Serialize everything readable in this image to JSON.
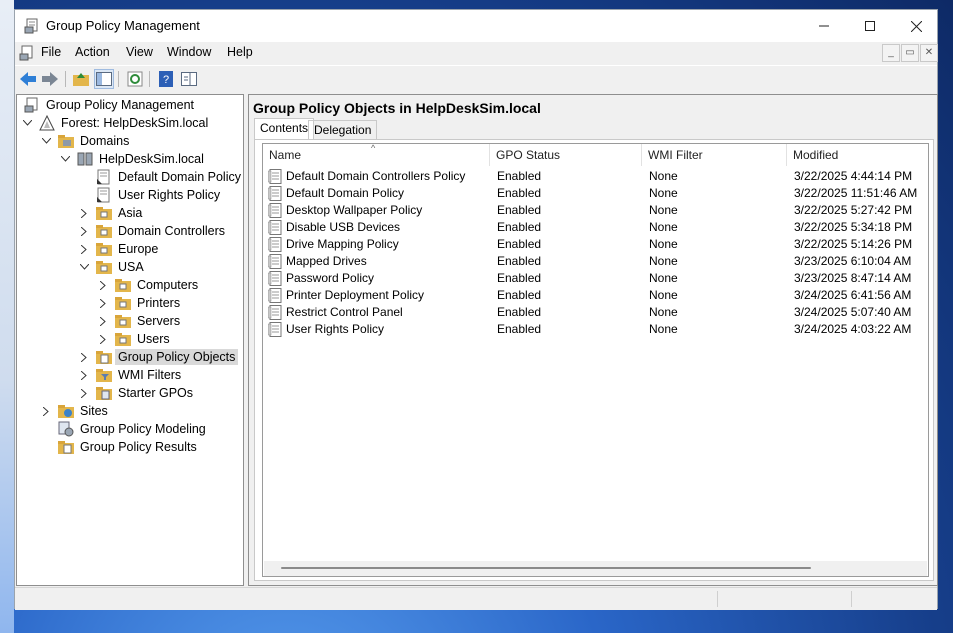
{
  "window": {
    "title": "Group Policy Management"
  },
  "menu": [
    "File",
    "Action",
    "View",
    "Window",
    "Help"
  ],
  "tree": {
    "root": "Group Policy Management",
    "forest": "Forest: HelpDeskSim.local",
    "domains": "Domains",
    "domain": "HelpDeskSim.local",
    "default_domain_policy": "Default Domain Policy",
    "user_rights_policy": "User Rights Policy",
    "asia": "Asia",
    "domain_controllers": "Domain Controllers",
    "europe": "Europe",
    "usa": "USA",
    "computers": "Computers",
    "printers": "Printers",
    "servers": "Servers",
    "users": "Users",
    "gpo": "Group Policy Objects",
    "wmi": "WMI Filters",
    "starter": "Starter GPOs",
    "sites": "Sites",
    "modeling": "Group Policy Modeling",
    "results": "Group Policy Results"
  },
  "right": {
    "title": "Group Policy Objects in HelpDeskSim.local",
    "tabs": [
      "Contents",
      "Delegation"
    ],
    "columns": [
      "Name",
      "GPO Status",
      "WMI Filter",
      "Modified"
    ],
    "rows": [
      [
        "Default Domain Controllers Policy",
        "Enabled",
        "None",
        "3/22/2025 4:44:14 PM"
      ],
      [
        "Default Domain Policy",
        "Enabled",
        "None",
        "3/22/2025 11:51:46 AM"
      ],
      [
        "Desktop Wallpaper Policy",
        "Enabled",
        "None",
        "3/22/2025 5:27:42 PM"
      ],
      [
        "Disable USB Devices",
        "Enabled",
        "None",
        "3/22/2025 5:34:18 PM"
      ],
      [
        "Drive Mapping Policy",
        "Enabled",
        "None",
        "3/22/2025 5:14:26 PM"
      ],
      [
        "Mapped Drives",
        "Enabled",
        "None",
        "3/23/2025 6:10:04 AM"
      ],
      [
        "Password Policy",
        "Enabled",
        "None",
        "3/23/2025 8:47:14 AM"
      ],
      [
        "Printer Deployment Policy",
        "Enabled",
        "None",
        "3/24/2025 6:41:56 AM"
      ],
      [
        "Restrict Control Panel",
        "Enabled",
        "None",
        "3/24/2025 5:07:40 AM"
      ],
      [
        "User Rights Policy",
        "Enabled",
        "None",
        "3/24/2025 4:03:22 AM"
      ]
    ]
  }
}
